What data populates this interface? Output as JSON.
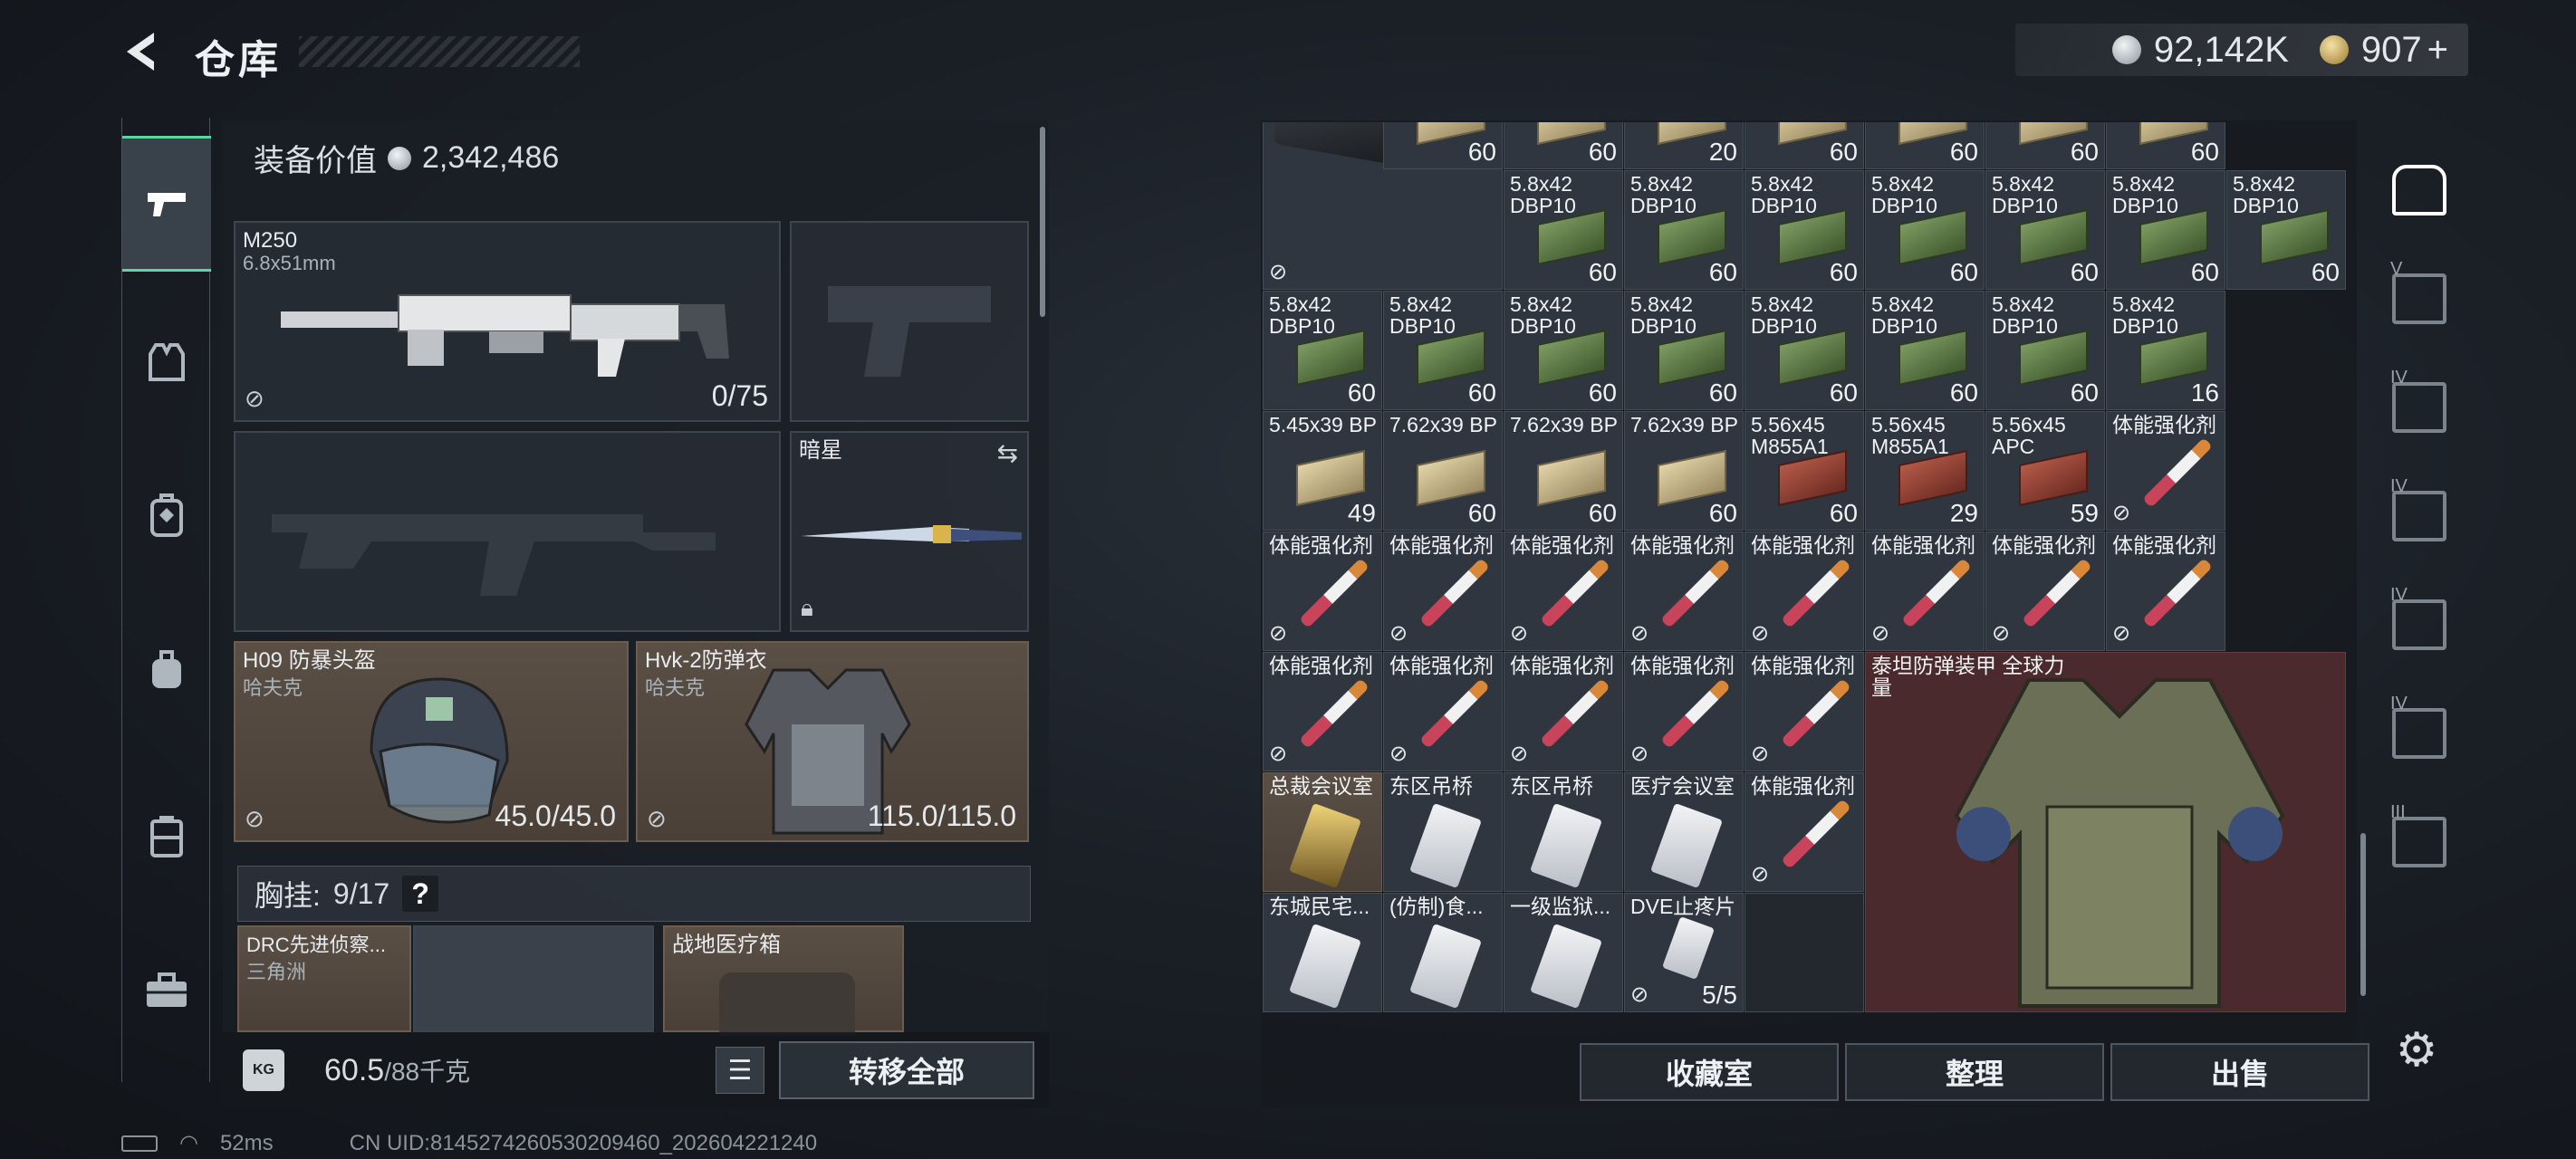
{
  "header": {
    "back_icon": "chevron-left-icon",
    "title": "仓库",
    "silver": "92,142K",
    "gold": "907",
    "plus": "+"
  },
  "left_nav": [
    {
      "icon": "pistol-icon",
      "active": true
    },
    {
      "icon": "vest-icon",
      "active": false
    },
    {
      "icon": "backpack-rig-icon",
      "active": false
    },
    {
      "icon": "backpack-icon",
      "active": false
    },
    {
      "icon": "case-icon",
      "active": false
    },
    {
      "icon": "toolbox-icon",
      "active": false
    }
  ],
  "equip": {
    "label": "装备价值",
    "value": "2,342,486"
  },
  "slots": {
    "primary": {
      "name": "M250",
      "sub": "6.8x51mm",
      "count": "0/75"
    },
    "knife": {
      "name": "暗星"
    },
    "helmet": {
      "name": "H09 防暴头盔",
      "sub": "哈夫克",
      "count": "45.0/45.0"
    },
    "armor": {
      "name": "Hvk-2防弹衣",
      "sub": "哈夫克",
      "count": "115.0/115.0"
    }
  },
  "chest": {
    "label": "胸挂:",
    "count": "9/17",
    "help": "?"
  },
  "chest_items": [
    {
      "name": "DRC先进侦察...",
      "sub": "三角洲"
    },
    {
      "name": "战地医疗箱"
    }
  ],
  "weight": {
    "icon_label": "KG",
    "value": "60.5",
    "max": "/88千克"
  },
  "transfer_all": "转移全部",
  "status": {
    "ping": "52ms",
    "uid": "CN UID:8145274260530209460_202604221240"
  },
  "grid_rows": [
    [
      {
        "t": "box",
        "n": ""
      },
      {
        "t": "tan",
        "l": "",
        "n": "60"
      },
      {
        "t": "tan",
        "l": "",
        "n": "60"
      },
      {
        "t": "tan",
        "l": "",
        "n": "20"
      },
      {
        "t": "tan",
        "l": "",
        "n": "60"
      },
      {
        "t": "tan",
        "l": "",
        "n": "60"
      },
      {
        "t": "tan",
        "l": "",
        "n": "60"
      },
      {
        "t": "tan",
        "l": "",
        "n": "60"
      }
    ],
    [
      {
        "t": "skip"
      },
      {
        "t": "green",
        "l": "5.8x42 DBP10",
        "n": "60"
      },
      {
        "t": "green",
        "l": "5.8x42 DBP10",
        "n": "60"
      },
      {
        "t": "green",
        "l": "5.8x42 DBP10",
        "n": "60"
      },
      {
        "t": "green",
        "l": "5.8x42 DBP10",
        "n": "60"
      },
      {
        "t": "green",
        "l": "5.8x42 DBP10",
        "n": "60"
      },
      {
        "t": "green",
        "l": "5.8x42 DBP10",
        "n": "60"
      },
      {
        "t": "green",
        "l": "5.8x42 DBP10",
        "n": "60"
      }
    ],
    [
      {
        "t": "green",
        "l": "5.8x42 DBP10",
        "n": "60"
      },
      {
        "t": "green",
        "l": "5.8x42 DBP10",
        "n": "60"
      },
      {
        "t": "green",
        "l": "5.8x42 DBP10",
        "n": "60"
      },
      {
        "t": "green",
        "l": "5.8x42 DBP10",
        "n": "60"
      },
      {
        "t": "green",
        "l": "5.8x42 DBP10",
        "n": "60"
      },
      {
        "t": "green",
        "l": "5.8x42 DBP10",
        "n": "60"
      },
      {
        "t": "green",
        "l": "5.8x42 DBP10",
        "n": "60"
      },
      {
        "t": "green",
        "l": "5.8x42 DBP10",
        "n": "16"
      }
    ],
    [
      {
        "t": "tan",
        "l": "5.45x39 BP",
        "n": "49"
      },
      {
        "t": "tan",
        "l": "7.62x39 BP",
        "n": "60"
      },
      {
        "t": "tan",
        "l": "7.62x39 BP",
        "n": "60"
      },
      {
        "t": "tan",
        "l": "7.62x39 BP",
        "n": "60"
      },
      {
        "t": "red",
        "l": "5.56x45 M855A1",
        "n": "60"
      },
      {
        "t": "red",
        "l": "5.56x45 M855A1",
        "n": "29"
      },
      {
        "t": "red",
        "l": "5.56x45 APC",
        "n": "59"
      },
      {
        "t": "syr",
        "l": "体能强化剂",
        "n": ""
      }
    ],
    [
      {
        "t": "syr",
        "l": "体能强化剂"
      },
      {
        "t": "syr",
        "l": "体能强化剂"
      },
      {
        "t": "syr",
        "l": "体能强化剂"
      },
      {
        "t": "syr",
        "l": "体能强化剂"
      },
      {
        "t": "syr",
        "l": "体能强化剂"
      },
      {
        "t": "syr",
        "l": "体能强化剂"
      },
      {
        "t": "syr",
        "l": "体能强化剂"
      },
      {
        "t": "syr",
        "l": "体能强化剂"
      }
    ],
    [
      {
        "t": "syr",
        "l": "体能强化剂"
      },
      {
        "t": "syr",
        "l": "体能强化剂"
      },
      {
        "t": "syr",
        "l": "体能强化剂"
      },
      {
        "t": "syr",
        "l": "体能强化剂"
      },
      {
        "t": "syr",
        "l": "体能强化剂"
      },
      {
        "t": "armorbig",
        "l": "泰坦防弹装甲 全球力量"
      }
    ],
    [
      {
        "t": "goldcard",
        "l": "总裁会议室"
      },
      {
        "t": "card",
        "l": "东区吊桥"
      },
      {
        "t": "card",
        "l": "东区吊桥"
      },
      {
        "t": "card",
        "l": "医疗会议室"
      },
      {
        "t": "syr",
        "l": "体能强化剂"
      }
    ],
    [
      {
        "t": "card",
        "l": "东城民宅..."
      },
      {
        "t": "card",
        "l": "(仿制)食..."
      },
      {
        "t": "card",
        "l": "一级监狱..."
      },
      {
        "t": "pill",
        "l": "DVE止疼片",
        "n": "5/5"
      }
    ]
  ],
  "grid_extra_syringe_row3": "体能强化剂",
  "bottom_buttons": [
    "收藏室",
    "整理",
    "出售"
  ],
  "right_nav": [
    {
      "icon": "safehouse-icon",
      "label": ""
    },
    {
      "icon": "workbench-v-icon",
      "label": "V"
    },
    {
      "icon": "station-iv-a-icon",
      "label": "IV"
    },
    {
      "icon": "station-iv-b-icon",
      "label": "IV"
    },
    {
      "icon": "station-iv-c-icon",
      "label": "IV"
    },
    {
      "icon": "station-iv-d-icon",
      "label": "IV"
    },
    {
      "icon": "station-iii-icon",
      "label": "III"
    }
  ],
  "settings_icon": "gear-icon"
}
